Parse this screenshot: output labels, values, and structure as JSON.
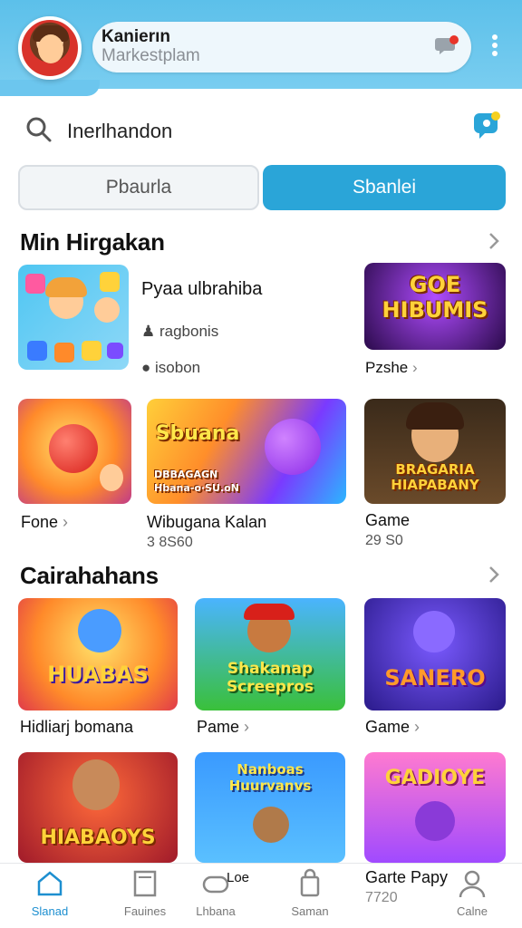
{
  "header": {
    "app_title": "Kanierın",
    "app_subtitle": "Markestplam"
  },
  "search": {
    "text": "Inerlhandon"
  },
  "segments": {
    "left": "Pbaurla",
    "right": "Sbanlei"
  },
  "section1": {
    "title": "Min Hirgakan",
    "featured": {
      "title": "Pyaa ulbrahiba",
      "meta1": "ragbonis",
      "meta2": "isobon",
      "side_label": "Pzshe"
    },
    "row2": [
      {
        "label": "Fone"
      },
      {
        "label": "Wibugana Kalan",
        "sub": "3 8S60",
        "art_top": "Sbuana",
        "art_bottom": "DBBAGAGN\nHbana-o·SU.oN"
      },
      {
        "label": "Game",
        "sub": "29 S0",
        "art": "BRAGARIA\nHIAPABANY"
      }
    ],
    "art_featured_right": "GOE\nHIBUMIS"
  },
  "section2": {
    "title": "Cairahahans",
    "row1": [
      {
        "label": "Hidliarj bomana",
        "art": "HUABAS"
      },
      {
        "label": "Pame",
        "art": "Shakanap\nScreepros"
      },
      {
        "label": "Game",
        "art": "SANERO"
      }
    ],
    "row2": [
      {
        "art": "HIABAOYS"
      },
      {
        "art": "Nanboas\nHuurvanvs"
      },
      {
        "label": "Garte Papy",
        "sub": "7720",
        "art": "GADIOYE"
      }
    ],
    "mid_label": "Loe"
  },
  "bottom_nav": [
    {
      "label": "Slanad",
      "icon": "home-icon",
      "active": true
    },
    {
      "label": "Fauines",
      "icon": "library-icon",
      "active": false
    },
    {
      "label": "Lhbana",
      "icon": "controller-icon",
      "active": false
    },
    {
      "label": "Saman",
      "icon": "bag-icon",
      "active": false
    },
    {
      "label": "Calne",
      "icon": "profile-icon",
      "active": false
    }
  ],
  "colors": {
    "header": "#5cc0ea",
    "accent": "#2aa5d8",
    "nav_active": "#1d8fd0"
  }
}
